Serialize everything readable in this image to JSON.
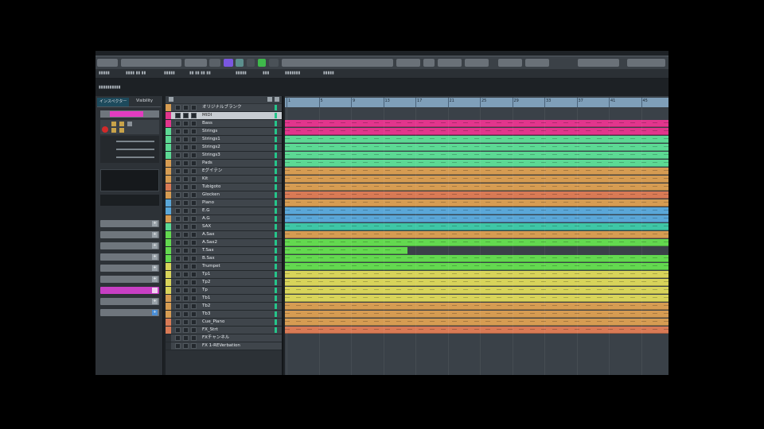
{
  "colors": {
    "magenta": "#e2358c",
    "green": "#5cd994",
    "lime": "#63d94f",
    "yellow": "#d8d45a",
    "orange": "#d69c52",
    "salmon": "#d97a55",
    "blue": "#5aa7d8",
    "teal": "#3ec6a6"
  },
  "toolbar": {
    "items": [
      "",
      "",
      "",
      "",
      "",
      "",
      ""
    ]
  },
  "infoline": {
    "fields": [
      "",
      "",
      "",
      "",
      "",
      "",
      "",
      ""
    ]
  },
  "inspector": {
    "tabs": [
      "インスペクター",
      "Visibility"
    ]
  },
  "tracks": [
    {
      "name": "オリジナルブランク",
      "color": "orange"
    },
    {
      "name": "MIDI",
      "color": "magenta"
    },
    {
      "name": "Bass",
      "color": "magenta"
    },
    {
      "name": "Strings",
      "color": "green"
    },
    {
      "name": "Strings1",
      "color": "green"
    },
    {
      "name": "Strings2",
      "color": "green"
    },
    {
      "name": "Strings3",
      "color": "green"
    },
    {
      "name": "Pads",
      "color": "orange"
    },
    {
      "name": "Eグイテン",
      "color": "orange"
    },
    {
      "name": "Kit",
      "color": "orange"
    },
    {
      "name": "Tubigoto",
      "color": "salmon"
    },
    {
      "name": "Glocken",
      "color": "orange"
    },
    {
      "name": "Piano",
      "color": "blue"
    },
    {
      "name": "E.G",
      "color": "blue"
    },
    {
      "name": "A.G",
      "color": "orange"
    },
    {
      "name": "SAX",
      "color": "green"
    },
    {
      "name": "A.Sax",
      "color": "lime"
    },
    {
      "name": "A.Sax2",
      "color": "lime"
    },
    {
      "name": "T.Sax",
      "color": "lime"
    },
    {
      "name": "B.Sax",
      "color": "lime"
    },
    {
      "name": "Trumpet",
      "color": "yellow"
    },
    {
      "name": "Tp1",
      "color": "yellow"
    },
    {
      "name": "Tp2",
      "color": "yellow"
    },
    {
      "name": "Tp",
      "color": "yellow"
    },
    {
      "name": "Tb1",
      "color": "orange"
    },
    {
      "name": "Tb2",
      "color": "orange"
    },
    {
      "name": "Tb3",
      "color": "orange"
    },
    {
      "name": "Cue_Piano",
      "color": "salmon"
    },
    {
      "name": "FX_Strt",
      "color": "salmon"
    },
    {
      "name": "FXチャンネル",
      "color": "none"
    },
    {
      "name": "FX 1-REVerbation",
      "color": "none"
    }
  ],
  "ruler": {
    "marks": [
      "1",
      "5",
      "9",
      "13",
      "17",
      "21",
      "25",
      "29",
      "33",
      "37",
      "41",
      "45"
    ]
  },
  "lanes": [
    {
      "color": "magenta",
      "start": 0.0,
      "end": 1.0
    },
    {
      "color": "magenta",
      "start": 0.0,
      "end": 1.0
    },
    {
      "color": "green",
      "start": 0.0,
      "end": 1.0
    },
    {
      "color": "green",
      "start": 0.0,
      "end": 1.0
    },
    {
      "color": "green",
      "start": 0.0,
      "end": 1.0
    },
    {
      "color": "green",
      "start": 0.0,
      "end": 1.0
    },
    {
      "color": "orange",
      "start": 0.0,
      "end": 1.0
    },
    {
      "color": "orange",
      "start": 0.0,
      "end": 1.0
    },
    {
      "color": "orange",
      "start": 0.0,
      "end": 1.0
    },
    {
      "color": "salmon",
      "start": 0.0,
      "end": 1.0
    },
    {
      "color": "orange",
      "start": 0.0,
      "end": 1.0
    },
    {
      "color": "blue",
      "start": 0.0,
      "end": 1.0
    },
    {
      "color": "blue",
      "start": 0.0,
      "end": 1.0
    },
    {
      "color": "teal",
      "start": 0.0,
      "end": 1.0
    },
    {
      "color": "orange",
      "start": 0.0,
      "end": 1.0
    },
    {
      "color": "lime",
      "start": 0.0,
      "end": 1.0
    },
    {
      "color": "lime",
      "start": 0.0,
      "end": 0.32
    },
    {
      "color": "lime",
      "start": 0.0,
      "end": 1.0
    },
    {
      "color": "lime",
      "start": 0.0,
      "end": 1.0
    },
    {
      "color": "yellow",
      "start": 0.0,
      "end": 1.0
    },
    {
      "color": "yellow",
      "start": 0.0,
      "end": 1.0
    },
    {
      "color": "yellow",
      "start": 0.0,
      "end": 1.0
    },
    {
      "color": "yellow",
      "start": 0.0,
      "end": 1.0
    },
    {
      "color": "orange",
      "start": 0.0,
      "end": 1.0
    },
    {
      "color": "orange",
      "start": 0.0,
      "end": 1.0
    },
    {
      "color": "orange",
      "start": 0.0,
      "end": 1.0
    },
    {
      "color": "salmon",
      "start": 0.0,
      "end": 1.0
    }
  ]
}
